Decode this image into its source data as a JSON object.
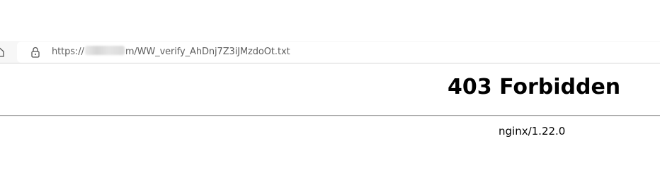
{
  "browser": {
    "address_bar": {
      "url_prefix": "https://",
      "url_suffix": "m/WW_verify_AhDnj7Z3iJMzdoOt.txt"
    },
    "icons": {
      "lock": "lock-icon",
      "partial_nav": "home-icon"
    },
    "colors": {
      "toolbar_bg": "#f7f7f7",
      "url_text": "#5f5f5f"
    }
  },
  "page": {
    "title": "403 Forbidden",
    "server": "nginx/1.22.0"
  }
}
